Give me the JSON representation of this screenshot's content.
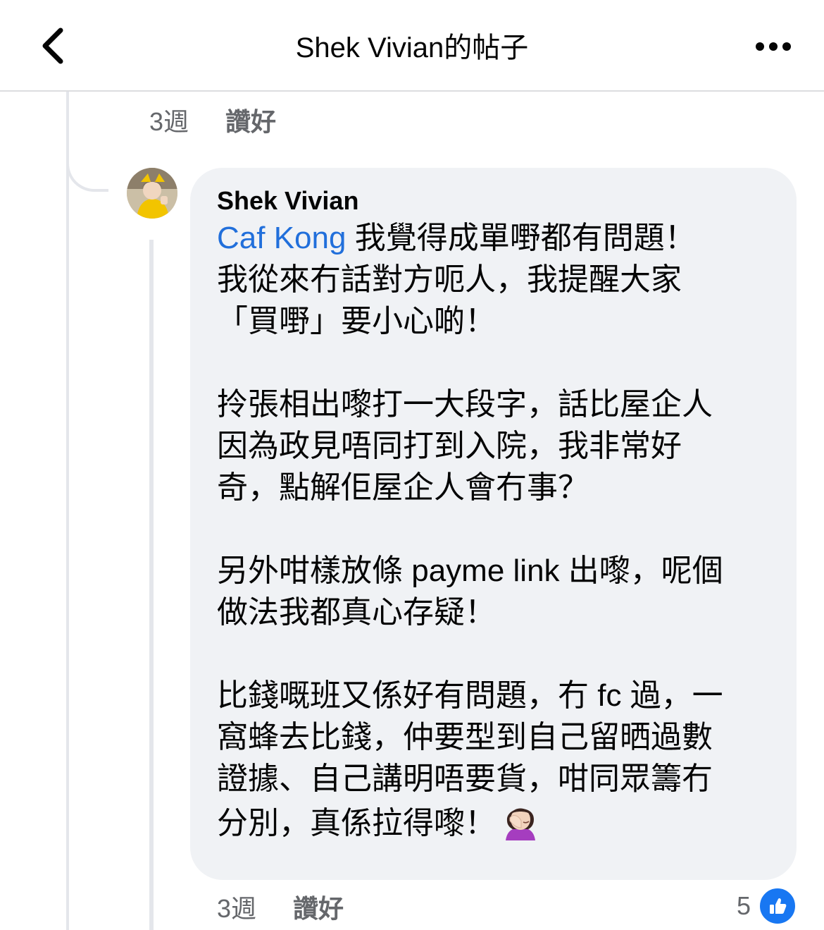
{
  "header": {
    "title": "Shek Vivian的帖子",
    "back_icon": "chevron-left-icon",
    "more_icon": "more-dots-icon"
  },
  "previous_comment": {
    "time": "3週",
    "like_label": "讚好"
  },
  "comment": {
    "author": "Shek Vivian",
    "mention": "Caf Kong",
    "paragraph1_rest": " 我覺得成單嘢都有問題！\n我從來冇話對方呃人，我提醒大家\n「買嘢」要小心啲！",
    "paragraph2": "拎張相出嚟打一大段字，話比屋企人\n因為政見唔同打到入院，我非常好\n奇，點解佢屋企人會冇事？",
    "paragraph3": "另外咁樣放條 payme link 出嚟，呢個\n做法我都真心存疑！",
    "paragraph4": "比錢嘅班又係好有問題，冇 fc 過，一\n窩蜂去比錢，仲要型到自己留晒過數\n證據、自己講明唔要貨，咁同眾籌冇\n分別，真係拉得嚟！",
    "emoji": "face-palm-emoji",
    "time": "3週",
    "like_label": "讚好",
    "reaction_count": "5",
    "reaction_icon": "like-thumb-icon"
  },
  "colors": {
    "mention": "#216fdb",
    "bubble_bg": "#f0f2f5",
    "meta_text": "#65676b",
    "like_blue": "#1877f2"
  }
}
